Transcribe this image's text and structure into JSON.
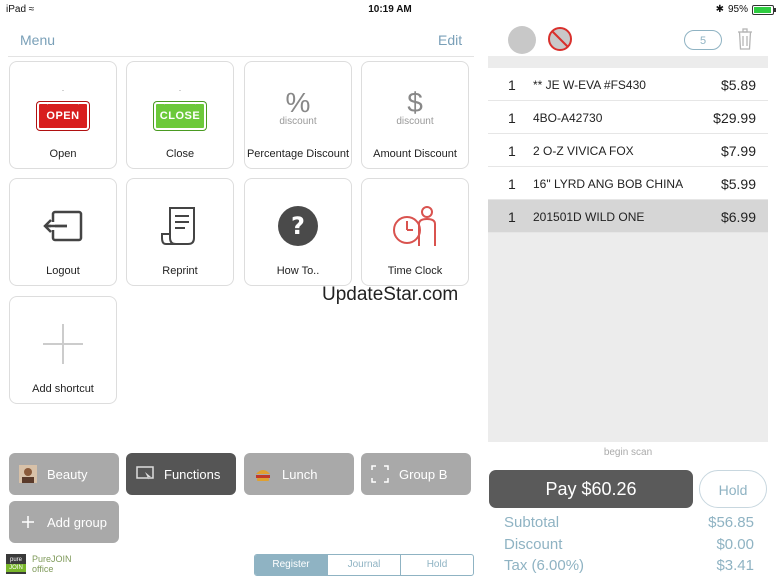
{
  "status_bar": {
    "carrier": "iPad",
    "time": "10:19 AM",
    "battery": "95%",
    "battery_level": 0.95
  },
  "header": {
    "menu_label": "Menu",
    "edit_label": "Edit"
  },
  "tiles": [
    {
      "label": "Open",
      "sign": "OPEN"
    },
    {
      "label": "Close",
      "sign": "CLOSE"
    },
    {
      "label": "Percentage Discount",
      "symbol": "%",
      "sub": "discount"
    },
    {
      "label": "Amount Discount",
      "symbol": "$",
      "sub": "discount"
    },
    {
      "label": "Logout"
    },
    {
      "label": "Reprint"
    },
    {
      "label": "How To.."
    },
    {
      "label": "Time Clock"
    },
    {
      "label": "Add shortcut"
    }
  ],
  "watermark": "UpdateStar.com",
  "groups": [
    {
      "label": "Beauty"
    },
    {
      "label": "Functions"
    },
    {
      "label": "Lunch"
    },
    {
      "label": "Group B"
    },
    {
      "label": "Add group"
    }
  ],
  "brand": {
    "logo_top": "pure",
    "logo_bottom": "JOIN",
    "line1": "PureJOIN",
    "line2": "office"
  },
  "tabs": [
    "Register",
    "Journal",
    "Hold"
  ],
  "cart": {
    "count": "5",
    "items": [
      {
        "qty": "1",
        "name": "** JE W-EVA #FS430",
        "price": "$5.89"
      },
      {
        "qty": "1",
        "name": "4BO-A42730",
        "price": "$29.99"
      },
      {
        "qty": "1",
        "name": "2 O-Z VIVICA FOX",
        "price": "$7.99"
      },
      {
        "qty": "1",
        "name": "16\" LYRD ANG BOB CHINA",
        "price": "$5.99"
      },
      {
        "qty": "1",
        "name": "201501D WILD ONE",
        "price": "$6.99"
      }
    ],
    "begin_scan": "begin scan",
    "pay_label": "Pay $60.26",
    "hold_label": "Hold",
    "totals": [
      {
        "label": "Subtotal",
        "value": "$56.85"
      },
      {
        "label": "Discount",
        "value": "$0.00"
      },
      {
        "label": "Tax (6.00%)",
        "value": "$3.41"
      }
    ]
  }
}
